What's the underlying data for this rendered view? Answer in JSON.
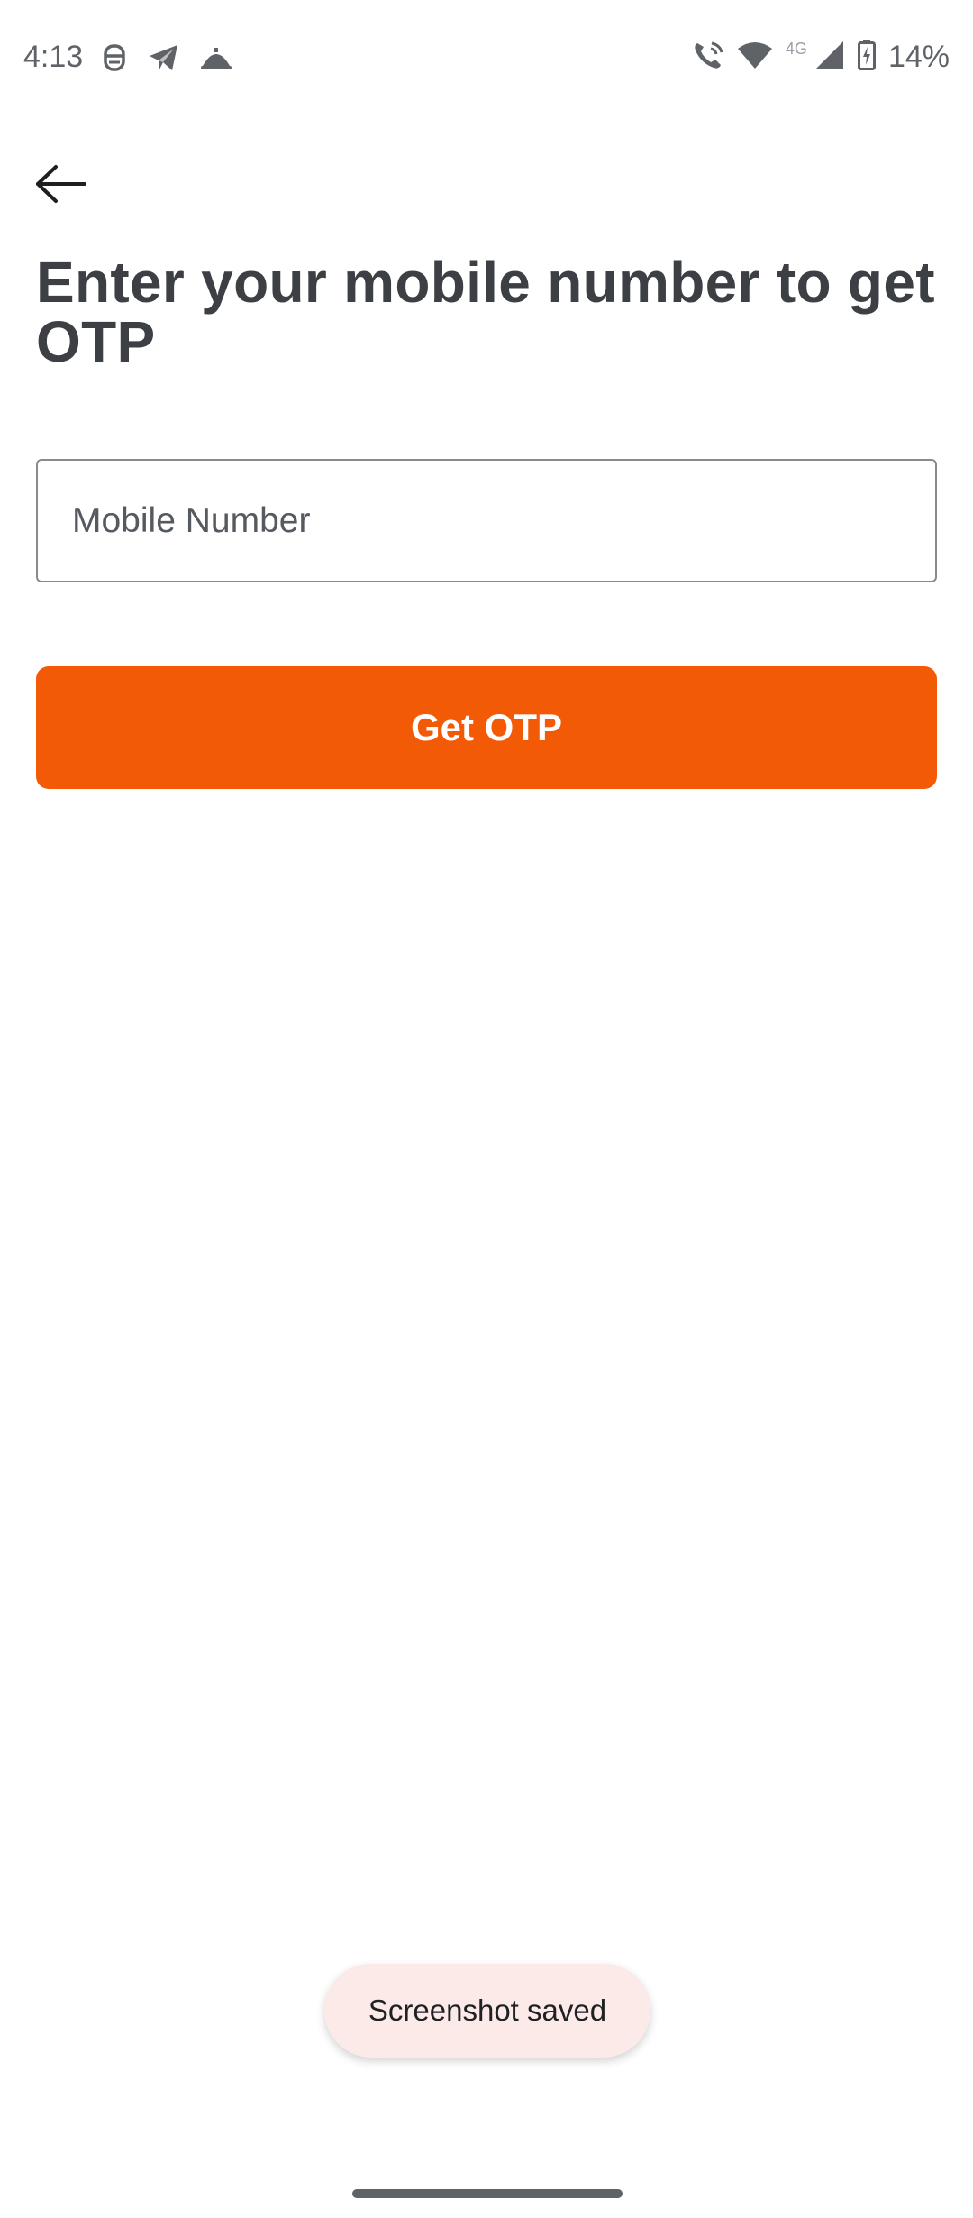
{
  "status_bar": {
    "time": "4:13",
    "network_type": "4G",
    "battery": "14%",
    "left_icons": [
      "notification-app-icon",
      "telegram-icon",
      "service-bell-icon"
    ],
    "right_icons": [
      "wifi-calling-icon",
      "wifi-icon",
      "signal-icon",
      "battery-charging-icon"
    ]
  },
  "header": {
    "back_icon": "arrow-left-icon",
    "title": "Enter your mobile number to get OTP"
  },
  "form": {
    "mobile_placeholder": "Mobile Number",
    "mobile_value": "",
    "submit_label": "Get OTP"
  },
  "toast": {
    "message": "Screenshot saved"
  },
  "colors": {
    "accent": "#f25a05",
    "title_text": "#3c3f44",
    "input_border": "#8a8a8a",
    "toast_bg": "#fbeae8"
  }
}
